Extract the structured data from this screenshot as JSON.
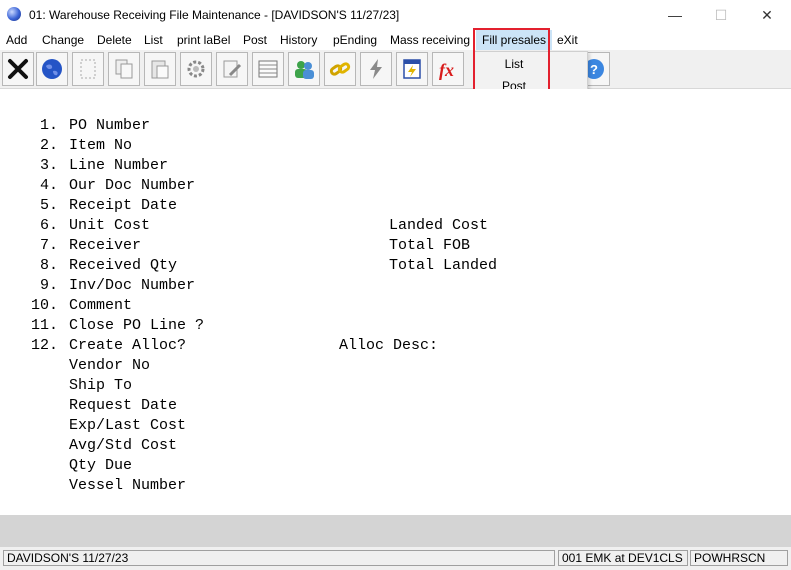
{
  "window": {
    "title": "01: Warehouse Receiving File Maintenance - [DAVIDSON'S 11/27/23]",
    "icon": "globe-app-icon",
    "controls": {
      "minimize": "—",
      "maximize": "☐",
      "close": "✕"
    }
  },
  "menu": {
    "items": [
      "Add",
      "Change",
      "Delete",
      "List",
      "print laBel",
      "Post",
      "History",
      "pEnding",
      "Mass receiving",
      "Fill presales",
      "eXit"
    ],
    "active": "Fill presales"
  },
  "dropdown": {
    "items": [
      "List",
      "Post"
    ]
  },
  "toolbar": {
    "buttons": [
      "exit-x",
      "globe",
      "blank",
      "copy",
      "paste",
      "settings-gear",
      "edit",
      "list-grid",
      "users",
      "link-chain",
      "lightning",
      "calculator",
      "function-fx",
      "help"
    ]
  },
  "fields": [
    {
      "num": "1.",
      "label": "PO Number"
    },
    {
      "num": "2.",
      "label": "Item No"
    },
    {
      "num": "3.",
      "label": "Line Number"
    },
    {
      "num": "4.",
      "label": "Our Doc Number"
    },
    {
      "num": "5.",
      "label": "Receipt Date"
    },
    {
      "num": "6.",
      "label": "Unit Cost"
    },
    {
      "num": "7.",
      "label": "Receiver"
    },
    {
      "num": "8.",
      "label": "Received Qty"
    },
    {
      "num": "9.",
      "label": "Inv/Doc Number"
    },
    {
      "num": "10.",
      "label": "Comment"
    },
    {
      "num": "11.",
      "label": "Close PO Line ?"
    },
    {
      "num": "12.",
      "label": "Create Alloc?"
    },
    {
      "num": "",
      "label": "Vendor No"
    },
    {
      "num": "",
      "label": "Ship To"
    },
    {
      "num": "",
      "label": "Request Date"
    },
    {
      "num": "",
      "label": "Exp/Last Cost"
    },
    {
      "num": "",
      "label": "Avg/Std Cost"
    },
    {
      "num": "",
      "label": "Qty Due"
    },
    {
      "num": "",
      "label": "Vessel Number"
    }
  ],
  "right_fields": [
    {
      "label": "Landed Cost",
      "row": 5
    },
    {
      "label": "Total FOB",
      "row": 6
    },
    {
      "label": "Total Landed",
      "row": 7
    },
    {
      "label": "Alloc Desc:",
      "row": 11
    }
  ],
  "status": {
    "company": "DAVIDSON'S 11/27/23",
    "session": "001 EMK at DEV1CLS",
    "program": "POWHRSCN"
  },
  "colors": {
    "highlight_border": "#e3202e",
    "menu_active_bg": "#cce4f7"
  }
}
